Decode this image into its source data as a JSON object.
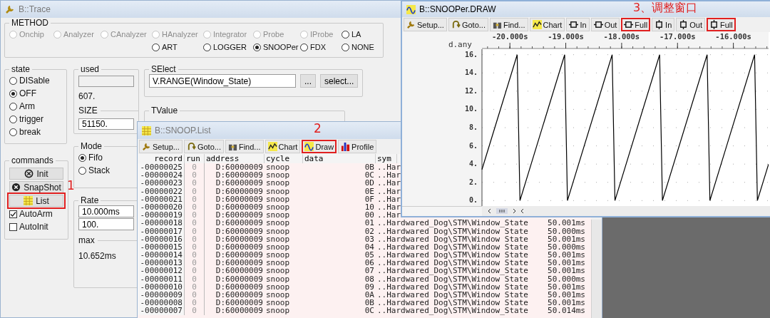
{
  "trace_window": {
    "title": "B::Trace",
    "active": false,
    "method": {
      "label": "METHOD",
      "rows": [
        [
          {
            "label": "Onchip",
            "selected": false,
            "disabled": true
          },
          {
            "label": "Analyzer",
            "selected": false,
            "disabled": true
          },
          {
            "label": "CAnalyzer",
            "selected": false,
            "disabled": true
          },
          {
            "label": "HAnalyzer",
            "selected": false,
            "disabled": true
          },
          {
            "label": "Integrator",
            "selected": false,
            "disabled": true
          },
          {
            "label": "Probe",
            "selected": false,
            "disabled": true
          },
          {
            "label": "IProbe",
            "selected": false,
            "disabled": true
          },
          {
            "label": "LA",
            "selected": false,
            "disabled": false
          }
        ],
        [
          "",
          "",
          "",
          {
            "label": "ART",
            "selected": false,
            "disabled": false
          },
          {
            "label": "LOGGER",
            "selected": false,
            "disabled": false
          },
          {
            "label": "SNOOPer",
            "selected": true,
            "disabled": false
          },
          {
            "label": "FDX",
            "selected": false,
            "disabled": false
          },
          {
            "label": "NONE",
            "selected": false,
            "disabled": false
          }
        ]
      ]
    },
    "state": {
      "label": "state",
      "options": [
        {
          "label": "DISable",
          "selected": false
        },
        {
          "label": "OFF",
          "selected": true
        },
        {
          "label": "Arm",
          "selected": false
        },
        {
          "label": "trigger",
          "selected": false
        },
        {
          "label": "break",
          "selected": false
        }
      ]
    },
    "commands": {
      "label": "commands",
      "buttons": [
        {
          "label": "Init",
          "kind": "init",
          "highlighted": false
        },
        {
          "label": "SnapShot",
          "kind": "snapshot",
          "highlighted": false
        },
        {
          "label": "List",
          "kind": "list",
          "highlighted": true
        }
      ],
      "checkboxes": [
        {
          "label": "AutoArm",
          "checked": true
        },
        {
          "label": "AutoInit",
          "checked": false
        }
      ]
    },
    "used": {
      "label": "used",
      "count": "607."
    },
    "size": {
      "label": "SIZE",
      "value": "51150."
    },
    "mode": {
      "label": "Mode",
      "options": [
        {
          "label": "Fifo",
          "selected": true
        },
        {
          "label": "Stack",
          "selected": false
        }
      ]
    },
    "rate": {
      "label": "Rate",
      "values": [
        "10.000ms",
        "100."
      ]
    },
    "max": {
      "label": "max",
      "value": "10.652ms"
    },
    "select": {
      "label": "SElect",
      "value": "V.RANGE(Window_State)",
      "buttons": [
        "...",
        "select..."
      ]
    },
    "tvalue": {
      "label": "TValue"
    }
  },
  "list_window": {
    "title": "B::SNOOP.List",
    "active": false,
    "toolbar": [
      {
        "label": "Setup...",
        "kind": "setup",
        "highlighted": false
      },
      {
        "label": "Goto...",
        "kind": "goto",
        "highlighted": false
      },
      {
        "label": "Find...",
        "kind": "find",
        "highlighted": false
      },
      {
        "label": "Chart",
        "kind": "chart",
        "highlighted": false
      },
      {
        "label": "Draw",
        "kind": "draw",
        "highlighted": true
      },
      {
        "label": "Profile",
        "kind": "profile",
        "highlighted": false
      }
    ],
    "columns": [
      "record",
      "run",
      "address",
      "cycle",
      "data",
      "sym"
    ],
    "rows": [
      {
        "record": "-00000025",
        "run": "0",
        "address": "D:60000009",
        "cycle": "snoop",
        "data": "0B",
        "symbol": "..Har"
      },
      {
        "record": "-00000024",
        "run": "0",
        "address": "D:60000009",
        "cycle": "snoop",
        "data": "0C",
        "symbol": "..Har"
      },
      {
        "record": "-00000023",
        "run": "0",
        "address": "D:60000009",
        "cycle": "snoop",
        "data": "0D",
        "symbol": "..Har"
      },
      {
        "record": "-00000022",
        "run": "0",
        "address": "D:60000009",
        "cycle": "snoop",
        "data": "0E",
        "symbol": "..Har"
      },
      {
        "record": "-00000021",
        "run": "0",
        "address": "D:60000009",
        "cycle": "snoop",
        "data": "0F",
        "symbol": "..Har"
      },
      {
        "record": "-00000020",
        "run": "0",
        "address": "D:60000009",
        "cycle": "snoop",
        "data": "10",
        "symbol": "..Har"
      },
      {
        "record": "-00000019",
        "run": "0",
        "address": "D:60000009",
        "cycle": "snoop",
        "data": "00",
        "symbol": "..Har"
      },
      {
        "record": "-00000018",
        "run": "0",
        "address": "D:60000009",
        "cycle": "snoop",
        "data": "01",
        "symbol": "..Hardwared_Dog\\STM\\Window_State",
        "time": "50.001ms"
      },
      {
        "record": "-00000017",
        "run": "0",
        "address": "D:60000009",
        "cycle": "snoop",
        "data": "02",
        "symbol": "..Hardwared_Dog\\STM\\Window_State",
        "time": "50.000ms"
      },
      {
        "record": "-00000016",
        "run": "0",
        "address": "D:60000009",
        "cycle": "snoop",
        "data": "03",
        "symbol": "..Hardwared_Dog\\STM\\Window_State",
        "time": "50.001ms"
      },
      {
        "record": "-00000015",
        "run": "0",
        "address": "D:60000009",
        "cycle": "snoop",
        "data": "04",
        "symbol": "..Hardwared_Dog\\STM\\Window_State",
        "time": "50.000ms"
      },
      {
        "record": "-00000014",
        "run": "0",
        "address": "D:60000009",
        "cycle": "snoop",
        "data": "05",
        "symbol": "..Hardwared_Dog\\STM\\Window_State",
        "time": "50.001ms"
      },
      {
        "record": "-00000013",
        "run": "0",
        "address": "D:60000009",
        "cycle": "snoop",
        "data": "06",
        "symbol": "..Hardwared_Dog\\STM\\Window_State",
        "time": "50.001ms"
      },
      {
        "record": "-00000012",
        "run": "0",
        "address": "D:60000009",
        "cycle": "snoop",
        "data": "07",
        "symbol": "..Hardwared_Dog\\STM\\Window_State",
        "time": "50.001ms"
      },
      {
        "record": "-00000011",
        "run": "0",
        "address": "D:60000009",
        "cycle": "snoop",
        "data": "08",
        "symbol": "..Hardwared_Dog\\STM\\Window_State",
        "time": "50.000ms"
      },
      {
        "record": "-00000010",
        "run": "0",
        "address": "D:60000009",
        "cycle": "snoop",
        "data": "09",
        "symbol": "..Hardwared_Dog\\STM\\Window_State",
        "time": "50.001ms"
      },
      {
        "record": "-00000009",
        "run": "0",
        "address": "D:60000009",
        "cycle": "snoop",
        "data": "0A",
        "symbol": "..Hardwared_Dog\\STM\\Window_State",
        "time": "50.001ms"
      },
      {
        "record": "-00000008",
        "run": "0",
        "address": "D:60000009",
        "cycle": "snoop",
        "data": "0B",
        "symbol": "..Hardwared_Dog\\STM\\Window_State",
        "time": "50.001ms"
      },
      {
        "record": "-00000007",
        "run": "0",
        "address": "D:60000009",
        "cycle": "snoop",
        "data": "0C",
        "symbol": "..Hardwared_Dog\\STM\\Window_State",
        "time": "50.014ms"
      }
    ]
  },
  "draw_window": {
    "title": "B::SNOOPer.DRAW",
    "active": true,
    "toolbar": [
      {
        "label": "Setup...",
        "kind": "setup",
        "highlighted": false
      },
      {
        "label": "Goto...",
        "kind": "goto",
        "highlighted": false
      },
      {
        "label": "Find...",
        "kind": "find",
        "highlighted": false
      },
      {
        "label": "Chart",
        "kind": "chart",
        "highlighted": false
      },
      {
        "label": "In",
        "kind": "hin",
        "highlighted": false
      },
      {
        "label": "Out",
        "kind": "hout",
        "highlighted": false
      },
      {
        "label": "Full",
        "kind": "hfull",
        "highlighted": true
      },
      {
        "label": "In",
        "kind": "vin",
        "highlighted": false
      },
      {
        "label": "Out",
        "kind": "vout",
        "highlighted": false
      },
      {
        "label": "Full",
        "kind": "vfull",
        "highlighted": true
      }
    ],
    "chart_data": {
      "type": "line",
      "ylabel": "d.any",
      "x": [
        -20500,
        -19870,
        -19820,
        -19020,
        -18970,
        -18170,
        -18120,
        -17320,
        -17270,
        -16470,
        -16420,
        -15620,
        -15570,
        -15370
      ],
      "series": [
        {
          "color": "#000000",
          "values": [
            3.4,
            16,
            0,
            16,
            0,
            16,
            0,
            16,
            0,
            16,
            0,
            16,
            0,
            4
          ]
        }
      ],
      "grid": true,
      "xlim": [
        -20500,
        -15370
      ],
      "ylim": [
        -0.6,
        16.6
      ],
      "xticks": [
        {
          "value": -20000,
          "label": "-20.000s"
        },
        {
          "value": -19000,
          "label": "-19.000s"
        },
        {
          "value": -18000,
          "label": "-18.000s"
        },
        {
          "value": -17000,
          "label": "-17.000s"
        },
        {
          "value": -16000,
          "label": "-16.000s"
        }
      ],
      "yticks": [
        {
          "value": 0,
          "label": "0."
        },
        {
          "value": 2,
          "label": "2."
        },
        {
          "value": 4,
          "label": "4."
        },
        {
          "value": 6,
          "label": "6."
        },
        {
          "value": 8,
          "label": "8."
        },
        {
          "value": 10,
          "label": "10."
        },
        {
          "value": 12,
          "label": "12."
        },
        {
          "value": 14,
          "label": "14."
        },
        {
          "value": 16,
          "label": "16."
        }
      ]
    }
  },
  "annotations": [
    {
      "label": "1"
    },
    {
      "label": "2"
    },
    {
      "label": "3、调整窗口"
    }
  ]
}
